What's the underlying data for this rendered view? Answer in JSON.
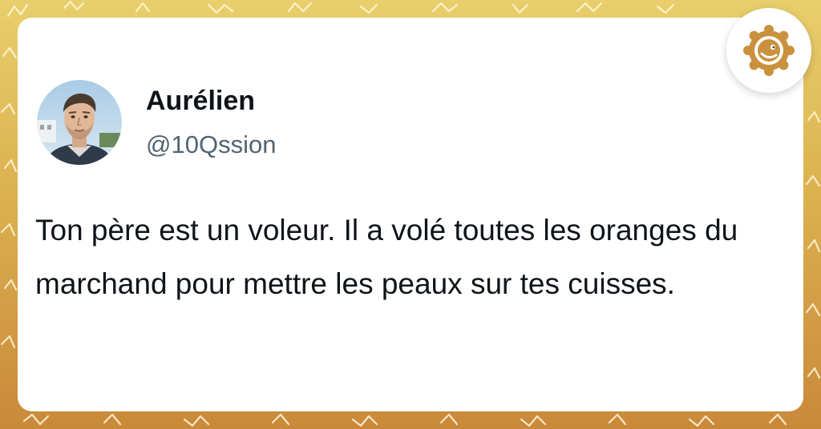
{
  "tweet": {
    "author_name": "Aurélien",
    "author_handle": "@10Qssion",
    "text": "Ton père est un voleur. Il a volé toutes les oranges du marchand pour mettre les peaux sur tes cuisses."
  },
  "icons": {
    "avatar": "user-photo-avatar",
    "brand_logo": "sun-face-logo-icon"
  },
  "colors": {
    "background_top": "#e8cf6c",
    "background_bottom": "#c9893a",
    "card": "#ffffff",
    "name_text": "#0f1419",
    "handle_text": "#536471",
    "logo_gold": "#c9913e"
  }
}
